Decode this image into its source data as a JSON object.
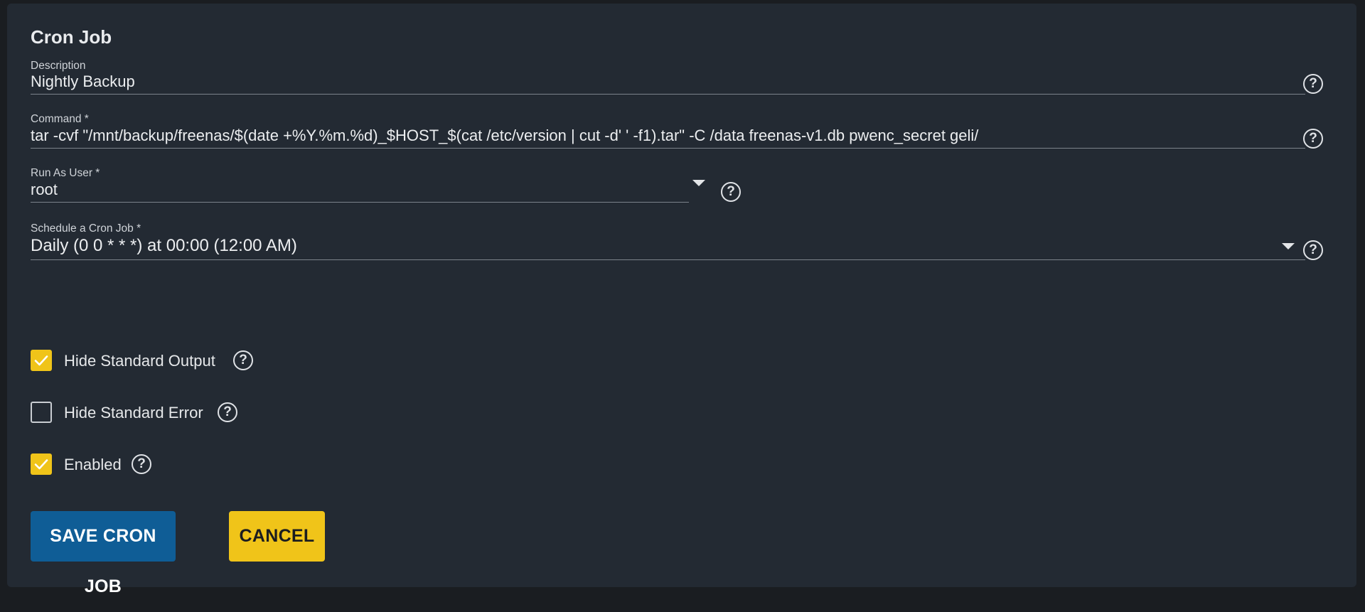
{
  "form": {
    "title": "Cron Job",
    "description": {
      "label": "Description",
      "value": "Nightly Backup"
    },
    "command": {
      "label": "Command *",
      "value": "tar -cvf \"/mnt/backup/freenas/$(date +%Y.%m.%d)_$HOST_$(cat /etc/version | cut -d' ' -f1).tar\" -C /data freenas-v1.db pwenc_secret geli/"
    },
    "run_as_user": {
      "label": "Run As User *",
      "value": "root"
    },
    "schedule": {
      "label": "Schedule a Cron Job *",
      "value": "Daily (0 0 * * *) at 00:00 (12:00 AM)"
    },
    "checkboxes": [
      {
        "label": "Hide Standard Output",
        "checked": true
      },
      {
        "label": "Hide Standard Error",
        "checked": false
      },
      {
        "label": "Enabled",
        "checked": true
      }
    ],
    "buttons": {
      "save_label": "SAVE CRON JOB",
      "cancel_label": "CANCEL"
    },
    "help_glyph": "?"
  },
  "colors": {
    "accent_yellow": "#f0c419",
    "primary_blue": "#0f5d96",
    "card_bg": "#232a33",
    "page_bg": "#1a1d21"
  },
  "icons": {
    "help": "help-circle-icon",
    "dropdown": "caret-down-icon",
    "check": "checkmark-icon"
  }
}
